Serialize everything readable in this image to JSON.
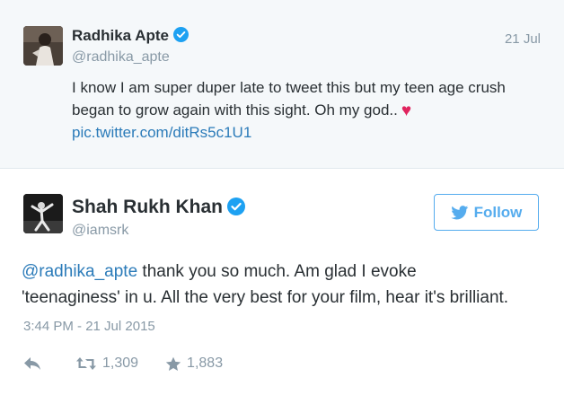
{
  "parent_tweet": {
    "name": "Radhika Apte",
    "handle": "@radhika_apte",
    "date": "21 Jul",
    "text": "I know I am super duper late to tweet this but my teen age crush began to grow again with this sight. Oh my god..",
    "heart": "♥",
    "link": "pic.twitter.com/ditRs5c1U1",
    "avatar_icon": "profile-photo"
  },
  "main_tweet": {
    "name": "Shah Rukh Khan",
    "handle": "@iamsrk",
    "follow_label": "Follow",
    "mention": "@radhika_apte",
    "text_line1_rest": " thank you so much. Am glad I evoke",
    "text_line2": "'teenaginess' in u. All the very best for your film, hear it's brilliant.",
    "timestamp": "3:44 PM - 21 Jul 2015",
    "retweet_count": "1,309",
    "favorite_count": "1,883",
    "avatar_icon": "profile-photo"
  },
  "colors": {
    "link": "#2b7bb9",
    "accent": "#55acee",
    "muted": "#8899a6",
    "heart": "#e0245e",
    "verified": "#1da1f2"
  }
}
